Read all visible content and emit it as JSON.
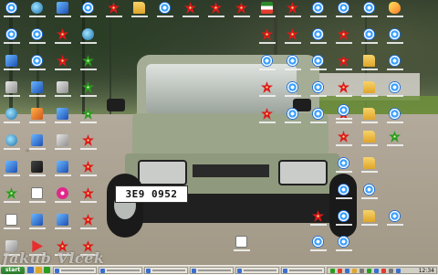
{
  "screen": {
    "title": "Windows desktop with car wallpaper"
  },
  "wallpaper": {
    "license_plate": "3E9 0952",
    "watermark": "Jakub Vlcek"
  },
  "desktop": {
    "icon_columns": [
      {
        "icons": [
          "t-swirl",
          "t-swirl",
          "t-blue",
          "t-gray",
          "t-globe",
          "t-globe",
          "t-blue",
          "t-green",
          "t-doc",
          "t-gray"
        ]
      },
      {
        "icons": [
          "t-globe",
          "t-swirl",
          "t-swirl",
          "t-blue",
          "t-orange",
          "t-blue",
          "t-dark",
          "t-doc",
          "t-blue",
          "t-play"
        ]
      },
      {
        "icons": [
          "t-blue",
          "t-red",
          "t-red",
          "t-gray",
          "t-blue",
          "t-gray",
          "t-blue",
          "t-pink",
          "t-blue",
          "t-red"
        ]
      },
      {
        "icons": [
          "t-swirl",
          "t-globe",
          "t-green",
          "t-green",
          "t-green",
          "t-red",
          "t-red",
          "t-red",
          "t-red",
          "t-red"
        ]
      }
    ],
    "top_row_right": [
      "t-red",
      "t-folder",
      "t-swirl",
      "t-red",
      "t-red",
      "t-red",
      "t-flag",
      "t-red",
      "t-swirl",
      "t-swirl",
      "t-swirl",
      "t-bird"
    ],
    "right_block": [
      [
        "t-red",
        "t-red",
        "t-swirl",
        "t-red",
        "t-swirl",
        "t-swirl"
      ],
      [
        "t-swirl",
        "t-swirl",
        "t-swirl",
        "t-red",
        "t-folder",
        "t-swirl"
      ],
      [
        "t-red",
        "t-swirl",
        "t-swirl",
        "t-red",
        "t-folder",
        "t-swirl"
      ],
      [
        "t-red",
        "t-swirl",
        "t-swirl",
        "t-red",
        "t-folder",
        "t-swirl"
      ]
    ],
    "bottom_right": [
      "t-swirl",
      "t-red",
      "t-folder",
      "t-green",
      "t-swirl",
      "t-swirl",
      "t-swirl",
      "t-folder",
      "t-swirl",
      "t-swirl",
      "t-folder",
      "t-red",
      "t-doc",
      "t-swirl",
      "t-swirl"
    ]
  },
  "taskbar": {
    "start_label": "start",
    "windows": [
      "Total Commander",
      "Mozilla Firefox",
      "Microsoft Word",
      "Windows Media",
      "Adobe Photoshop",
      "Outlook Express"
    ],
    "clock": "12:34"
  }
}
